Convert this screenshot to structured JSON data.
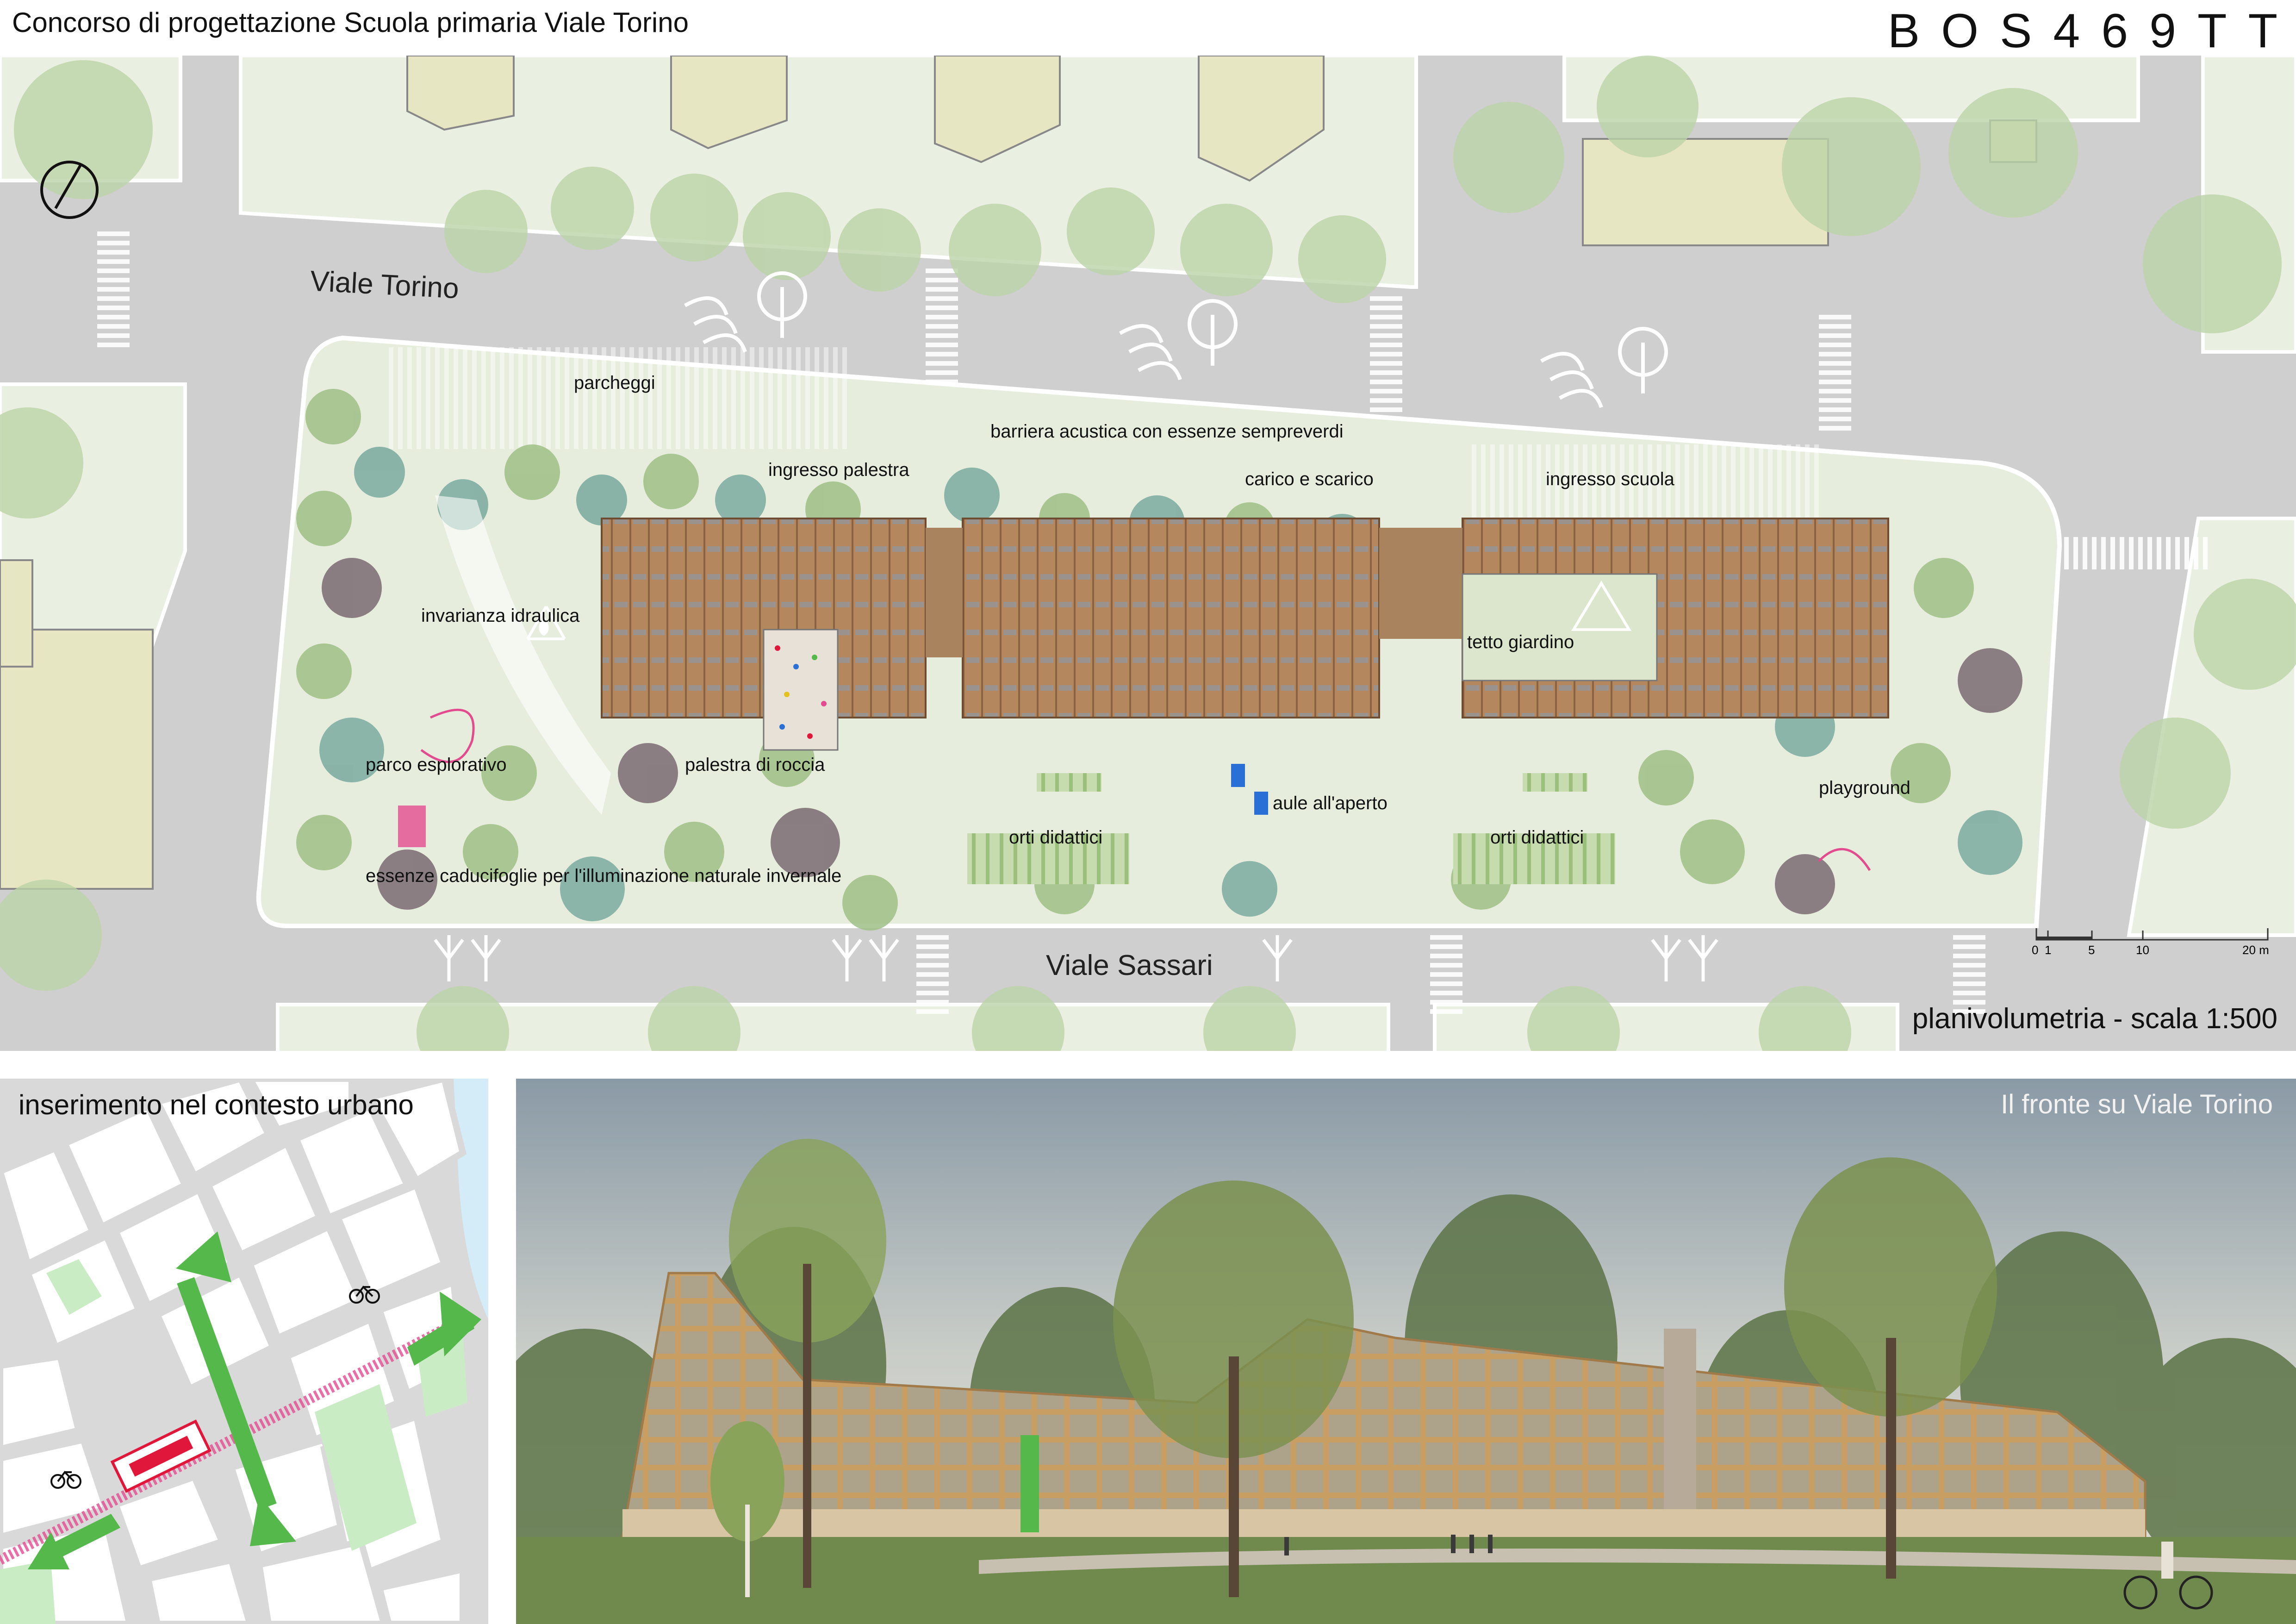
{
  "header": {
    "title": "Concorso di progettazione Scuola primaria Viale Torino",
    "code": [
      "B",
      "O",
      "S",
      "4",
      "6",
      "9",
      "T",
      "T"
    ]
  },
  "plan": {
    "streets": {
      "top": "Viale Torino",
      "bottom": "Viale Sassari"
    },
    "labels": {
      "parcheggi": "parcheggi",
      "ingresso_palestra": "ingresso palestra",
      "barriera": "barriera acustica con essenze sempreverdi",
      "carico": "carico  e scarico",
      "ingresso_scuola": "ingresso scuola",
      "invarianza": "invarianza idraulica",
      "tetto": "tetto giardino",
      "parco": "parco esplorativo",
      "palestra_roccia": "palestra di roccia",
      "aule": "aule all'aperto",
      "playground": "playground",
      "orti_1": "orti didattici",
      "orti_2": "orti didattici",
      "essenze": "essenze caducifoglie per l'illuminazione naturale invernale"
    },
    "scale": {
      "title": "planivolumetria - scala 1:500",
      "ticks": [
        "0",
        "1",
        "5",
        "10",
        "20 m"
      ]
    },
    "icons": [
      "north-arrow-icon",
      "recycle-water-icon",
      "wind-icon",
      "tree-icon",
      "bicycle-icon"
    ]
  },
  "context": {
    "title": "inserimento nel contesto urbano"
  },
  "render": {
    "title": "Il fronte su Viale Torino"
  },
  "colors": {
    "road": "#cfcfcf",
    "lot": "#e7eddc",
    "tree_green": "#9fbf86",
    "tree_teal": "#7aaaa0",
    "tree_plum": "#7a6a72",
    "wood": "#b5875e",
    "accent_green": "#55b84a",
    "accent_red": "#e0173a",
    "accent_pink": "#e34b8f",
    "water": "#d4ecf7"
  }
}
